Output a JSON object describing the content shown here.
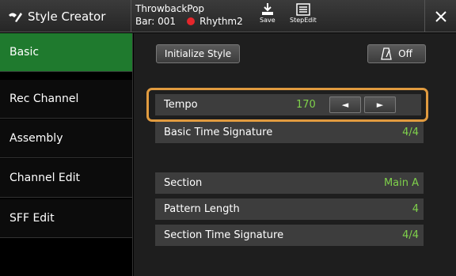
{
  "header": {
    "app_title": "Style Creator",
    "style_name": "ThrowbackPop",
    "bar": "Bar: 001",
    "record_part": "Rhythm2",
    "save_label": "Save",
    "stepedit_label": "StepEdit"
  },
  "sidebar": {
    "items": [
      {
        "label": "Basic"
      },
      {
        "label": "Rec Channel"
      },
      {
        "label": "Assembly"
      },
      {
        "label": "Channel Edit"
      },
      {
        "label": "SFF Edit"
      }
    ]
  },
  "main": {
    "initialize_label": "Initialize Style",
    "metronome_label": "Off",
    "tempo": {
      "label": "Tempo",
      "value": "170",
      "dec": "◄",
      "inc": "►"
    },
    "basic_time_sig": {
      "label": "Basic Time Signature",
      "value": "4/4"
    },
    "section": {
      "label": "Section",
      "value": "Main A"
    },
    "pattern_length": {
      "label": "Pattern Length",
      "value": "4"
    },
    "section_time_sig": {
      "label": "Section Time Signature",
      "value": "4/4"
    }
  }
}
